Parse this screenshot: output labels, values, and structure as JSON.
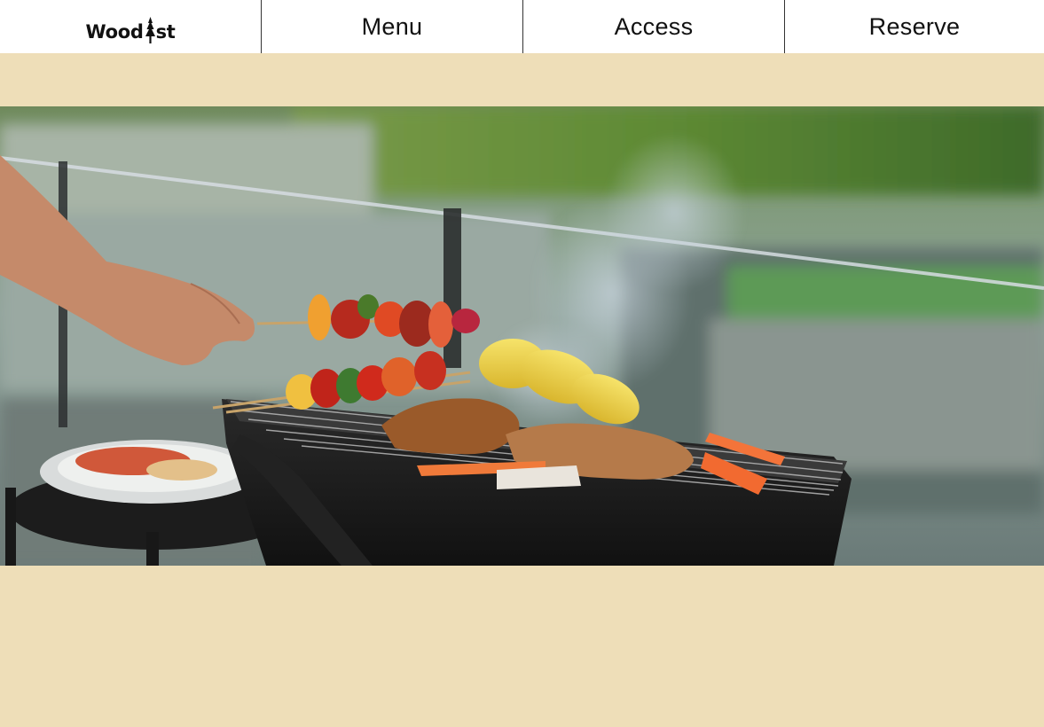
{
  "header": {
    "logo": {
      "text_left": "Wood",
      "text_right": "st",
      "icon": "tree-icon"
    },
    "nav": [
      {
        "label": "Menu"
      },
      {
        "label": "Access"
      },
      {
        "label": "Reserve"
      }
    ]
  },
  "hero": {
    "image_subject": "barbecue grill with skewers, corn, meat and carrots by a river"
  },
  "colors": {
    "background": "#eedeb8",
    "nav_background": "#ffffff",
    "nav_text": "#111111",
    "divider": "#333333"
  }
}
